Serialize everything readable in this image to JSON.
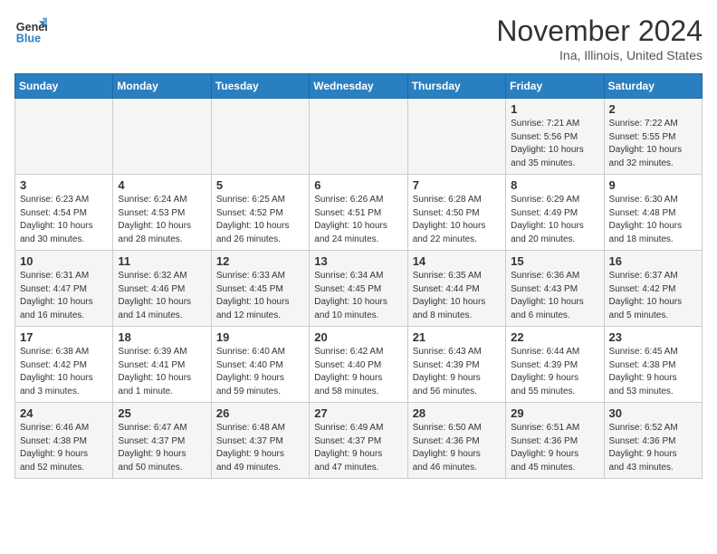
{
  "header": {
    "logo_line1": "General",
    "logo_line2": "Blue",
    "month": "November 2024",
    "location": "Ina, Illinois, United States"
  },
  "days_of_week": [
    "Sunday",
    "Monday",
    "Tuesday",
    "Wednesday",
    "Thursday",
    "Friday",
    "Saturday"
  ],
  "weeks": [
    [
      {
        "day": "",
        "info": ""
      },
      {
        "day": "",
        "info": ""
      },
      {
        "day": "",
        "info": ""
      },
      {
        "day": "",
        "info": ""
      },
      {
        "day": "",
        "info": ""
      },
      {
        "day": "1",
        "info": "Sunrise: 7:21 AM\nSunset: 5:56 PM\nDaylight: 10 hours\nand 35 minutes."
      },
      {
        "day": "2",
        "info": "Sunrise: 7:22 AM\nSunset: 5:55 PM\nDaylight: 10 hours\nand 32 minutes."
      }
    ],
    [
      {
        "day": "3",
        "info": "Sunrise: 6:23 AM\nSunset: 4:54 PM\nDaylight: 10 hours\nand 30 minutes."
      },
      {
        "day": "4",
        "info": "Sunrise: 6:24 AM\nSunset: 4:53 PM\nDaylight: 10 hours\nand 28 minutes."
      },
      {
        "day": "5",
        "info": "Sunrise: 6:25 AM\nSunset: 4:52 PM\nDaylight: 10 hours\nand 26 minutes."
      },
      {
        "day": "6",
        "info": "Sunrise: 6:26 AM\nSunset: 4:51 PM\nDaylight: 10 hours\nand 24 minutes."
      },
      {
        "day": "7",
        "info": "Sunrise: 6:28 AM\nSunset: 4:50 PM\nDaylight: 10 hours\nand 22 minutes."
      },
      {
        "day": "8",
        "info": "Sunrise: 6:29 AM\nSunset: 4:49 PM\nDaylight: 10 hours\nand 20 minutes."
      },
      {
        "day": "9",
        "info": "Sunrise: 6:30 AM\nSunset: 4:48 PM\nDaylight: 10 hours\nand 18 minutes."
      }
    ],
    [
      {
        "day": "10",
        "info": "Sunrise: 6:31 AM\nSunset: 4:47 PM\nDaylight: 10 hours\nand 16 minutes."
      },
      {
        "day": "11",
        "info": "Sunrise: 6:32 AM\nSunset: 4:46 PM\nDaylight: 10 hours\nand 14 minutes."
      },
      {
        "day": "12",
        "info": "Sunrise: 6:33 AM\nSunset: 4:45 PM\nDaylight: 10 hours\nand 12 minutes."
      },
      {
        "day": "13",
        "info": "Sunrise: 6:34 AM\nSunset: 4:45 PM\nDaylight: 10 hours\nand 10 minutes."
      },
      {
        "day": "14",
        "info": "Sunrise: 6:35 AM\nSunset: 4:44 PM\nDaylight: 10 hours\nand 8 minutes."
      },
      {
        "day": "15",
        "info": "Sunrise: 6:36 AM\nSunset: 4:43 PM\nDaylight: 10 hours\nand 6 minutes."
      },
      {
        "day": "16",
        "info": "Sunrise: 6:37 AM\nSunset: 4:42 PM\nDaylight: 10 hours\nand 5 minutes."
      }
    ],
    [
      {
        "day": "17",
        "info": "Sunrise: 6:38 AM\nSunset: 4:42 PM\nDaylight: 10 hours\nand 3 minutes."
      },
      {
        "day": "18",
        "info": "Sunrise: 6:39 AM\nSunset: 4:41 PM\nDaylight: 10 hours\nand 1 minute."
      },
      {
        "day": "19",
        "info": "Sunrise: 6:40 AM\nSunset: 4:40 PM\nDaylight: 9 hours\nand 59 minutes."
      },
      {
        "day": "20",
        "info": "Sunrise: 6:42 AM\nSunset: 4:40 PM\nDaylight: 9 hours\nand 58 minutes."
      },
      {
        "day": "21",
        "info": "Sunrise: 6:43 AM\nSunset: 4:39 PM\nDaylight: 9 hours\nand 56 minutes."
      },
      {
        "day": "22",
        "info": "Sunrise: 6:44 AM\nSunset: 4:39 PM\nDaylight: 9 hours\nand 55 minutes."
      },
      {
        "day": "23",
        "info": "Sunrise: 6:45 AM\nSunset: 4:38 PM\nDaylight: 9 hours\nand 53 minutes."
      }
    ],
    [
      {
        "day": "24",
        "info": "Sunrise: 6:46 AM\nSunset: 4:38 PM\nDaylight: 9 hours\nand 52 minutes."
      },
      {
        "day": "25",
        "info": "Sunrise: 6:47 AM\nSunset: 4:37 PM\nDaylight: 9 hours\nand 50 minutes."
      },
      {
        "day": "26",
        "info": "Sunrise: 6:48 AM\nSunset: 4:37 PM\nDaylight: 9 hours\nand 49 minutes."
      },
      {
        "day": "27",
        "info": "Sunrise: 6:49 AM\nSunset: 4:37 PM\nDaylight: 9 hours\nand 47 minutes."
      },
      {
        "day": "28",
        "info": "Sunrise: 6:50 AM\nSunset: 4:36 PM\nDaylight: 9 hours\nand 46 minutes."
      },
      {
        "day": "29",
        "info": "Sunrise: 6:51 AM\nSunset: 4:36 PM\nDaylight: 9 hours\nand 45 minutes."
      },
      {
        "day": "30",
        "info": "Sunrise: 6:52 AM\nSunset: 4:36 PM\nDaylight: 9 hours\nand 43 minutes."
      }
    ]
  ]
}
